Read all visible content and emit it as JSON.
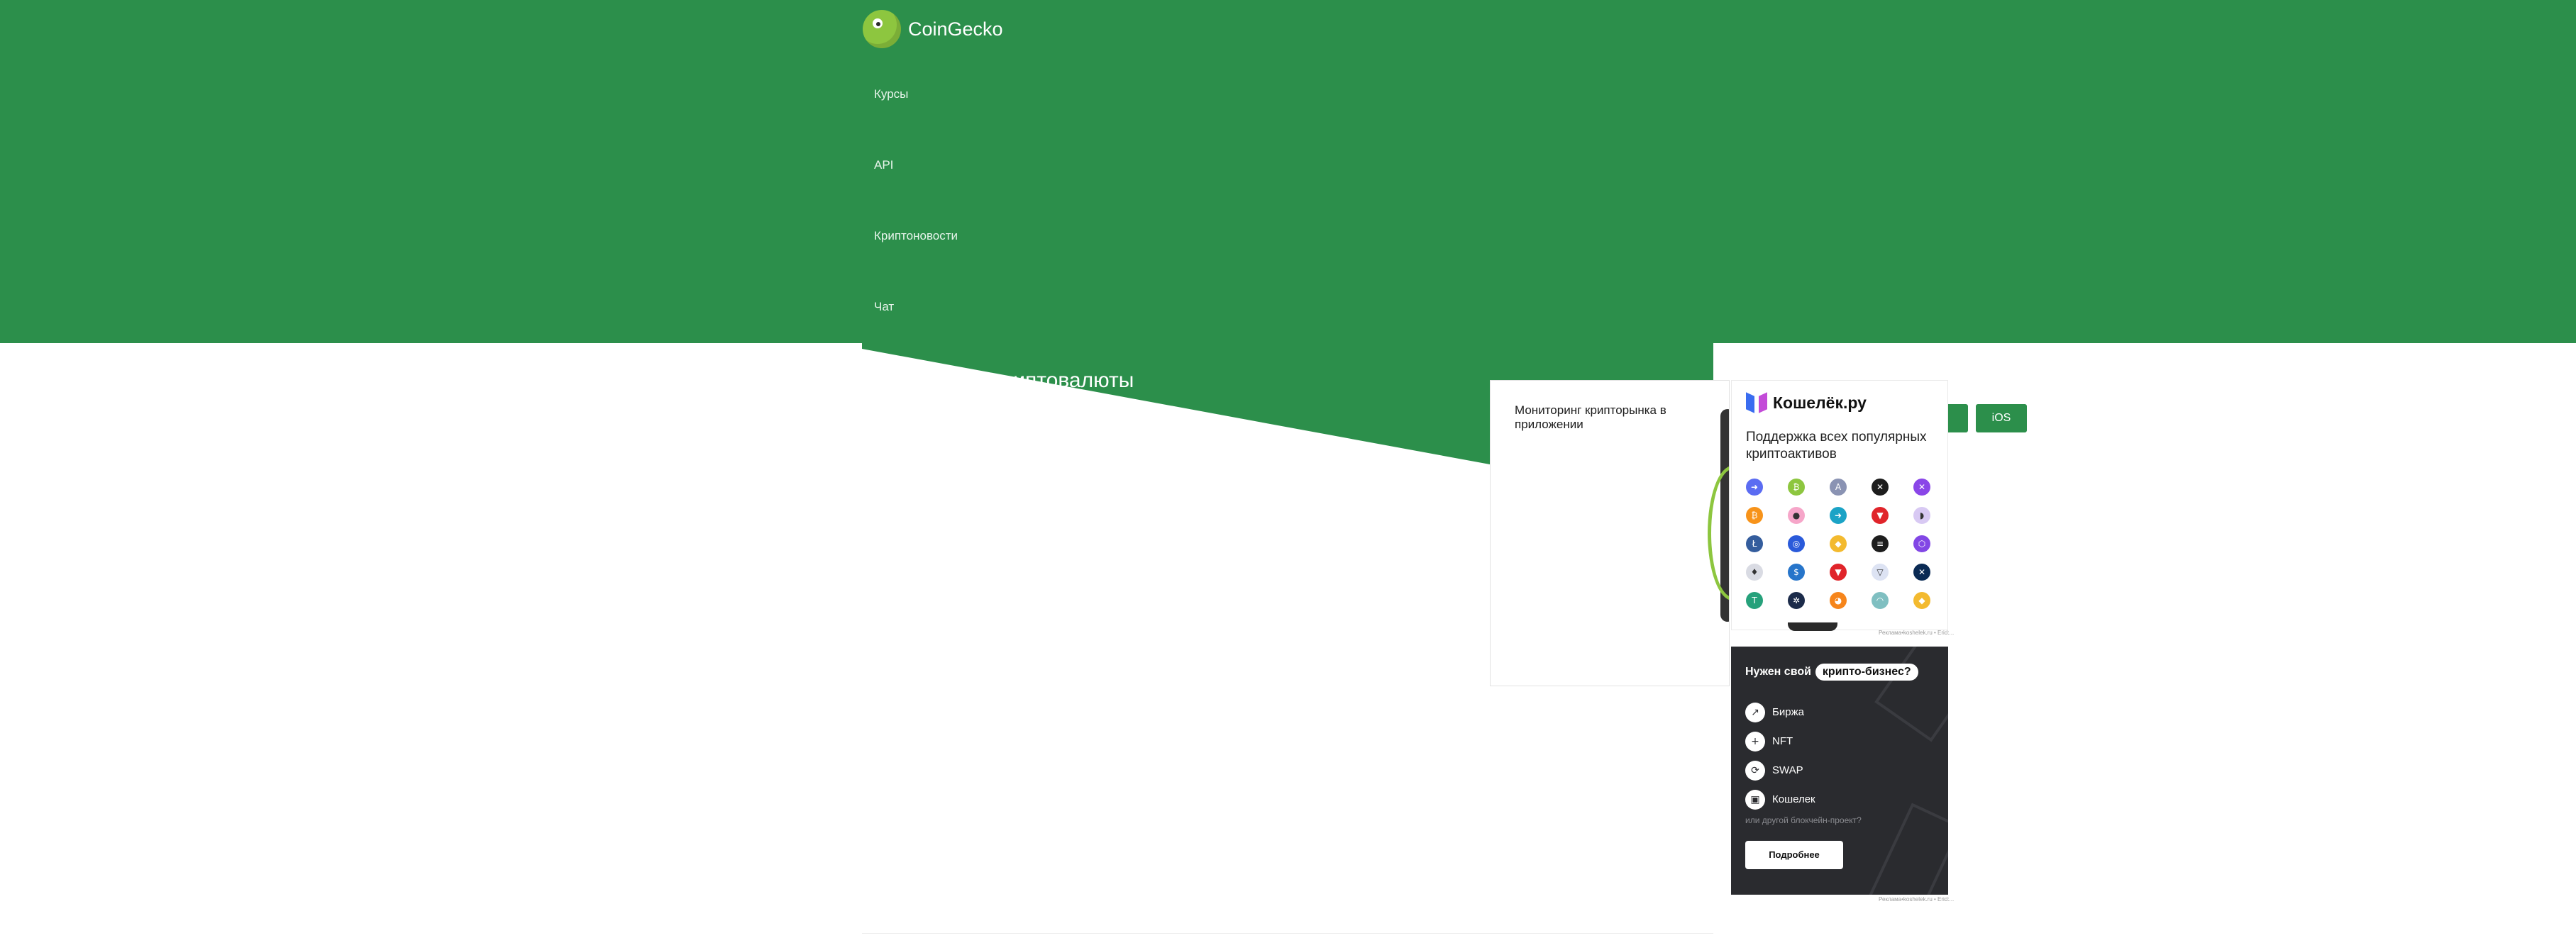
{
  "brand": {
    "name": "CoinGecko"
  },
  "nav": {
    "items": [
      "Курсы",
      "API",
      "Криптоновости",
      "Чат"
    ]
  },
  "main": {
    "title": "Популярные криптовалюты"
  },
  "app_promo": {
    "text": "Мониторинг крипторынка в приложении",
    "ios": "iOS"
  },
  "ad_koshelek": {
    "title": "Кошелёк.ру",
    "subtitle": "Поддержка всех популярных криптоактивов",
    "credit": "Реклама•koshelek.ru • Erid:...",
    "coins": [
      {
        "glyph": "➜",
        "color": "#5b6cf2"
      },
      {
        "glyph": "₿",
        "color": "#8dc63f"
      },
      {
        "glyph": "A",
        "color": "#8a93b3"
      },
      {
        "glyph": "✕",
        "color": "#1d1d1d"
      },
      {
        "glyph": "✕",
        "color": "#8a46e8"
      },
      {
        "glyph": "₿",
        "color": "#f7931a"
      },
      {
        "glyph": "●",
        "color": "#f6a6c9"
      },
      {
        "glyph": "➜",
        "color": "#1ba3c6"
      },
      {
        "glyph": "▼",
        "color": "#e0242a"
      },
      {
        "glyph": "◗",
        "color": "#d8c9f3"
      },
      {
        "glyph": "Ł",
        "color": "#345d9d"
      },
      {
        "glyph": "◎",
        "color": "#2a5ada"
      },
      {
        "glyph": "◆",
        "color": "#f3ba2f"
      },
      {
        "glyph": "≡",
        "color": "#1d1d1d"
      },
      {
        "glyph": "⬡",
        "color": "#8247e5"
      },
      {
        "glyph": "♦",
        "color": "#d9dbe3"
      },
      {
        "glyph": "$",
        "color": "#2775ca"
      },
      {
        "glyph": "▼",
        "color": "#e0242a"
      },
      {
        "glyph": "▽",
        "color": "#dde3f3"
      },
      {
        "glyph": "✕",
        "color": "#0a2a54"
      },
      {
        "glyph": "T",
        "color": "#26a17b"
      },
      {
        "glyph": "✲",
        "color": "#1c2b4a"
      },
      {
        "glyph": "◕",
        "color": "#f6851b"
      },
      {
        "glyph": "◠",
        "color": "#7fbfc1"
      },
      {
        "glyph": "◆",
        "color": "#f3ba2f"
      }
    ]
  },
  "ad_business": {
    "title_pre": "Нужен свой",
    "title_pill": "крипто-бизнес?",
    "items": [
      {
        "icon": "chart-icon",
        "glyph": "↗",
        "label": "Биржа"
      },
      {
        "icon": "plus-icon",
        "glyph": "+",
        "label": "NFT"
      },
      {
        "icon": "swap-icon",
        "glyph": "⟳",
        "label": "SWAP"
      },
      {
        "icon": "wallet-icon",
        "glyph": "▣",
        "label": "Кошелек"
      }
    ],
    "other": "или другой блокчейн-проект?",
    "button": "Подробнее",
    "credit": "Реклама•koshelek.ru • Erid:..."
  }
}
